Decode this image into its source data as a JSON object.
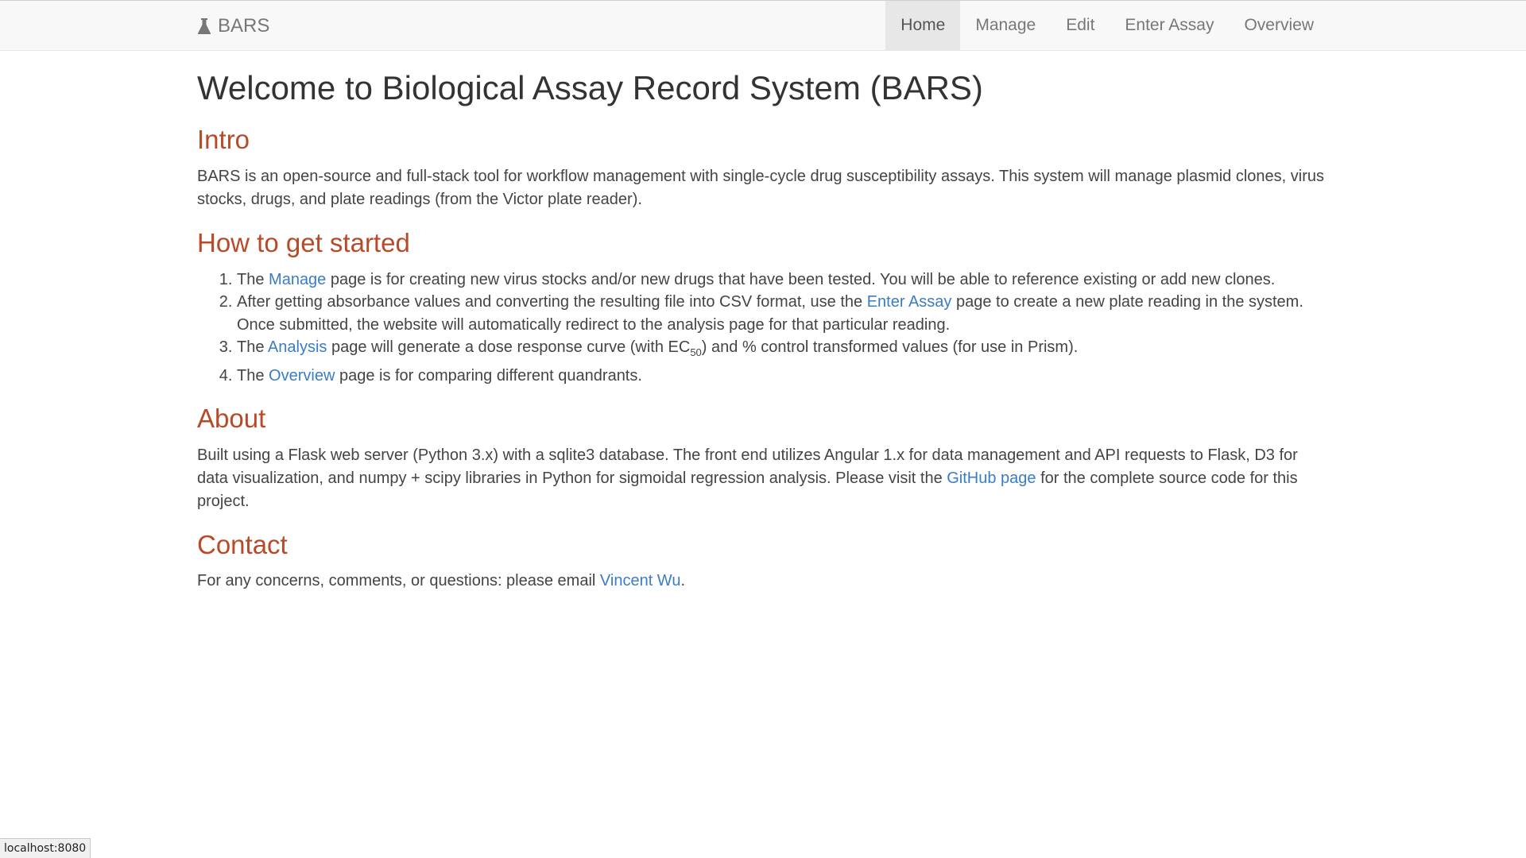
{
  "navbar": {
    "brand": "BARS",
    "items": [
      {
        "label": "Home",
        "active": true
      },
      {
        "label": "Manage",
        "active": false
      },
      {
        "label": "Edit",
        "active": false
      },
      {
        "label": "Enter Assay",
        "active": false
      },
      {
        "label": "Overview",
        "active": false
      }
    ]
  },
  "page": {
    "title": "Welcome to Biological Assay Record System (BARS)"
  },
  "intro": {
    "heading": "Intro",
    "text": "BARS is an open-source and full-stack tool for workflow management with single-cycle drug susceptibility assays. This system will manage plasmid clones, virus stocks, drugs, and plate readings (from the Victor plate reader)."
  },
  "getting_started": {
    "heading": "How to get started",
    "step1": {
      "before": "The ",
      "link": "Manage",
      "after": " page is for creating new virus stocks and/or new drugs that have been tested. You will be able to reference existing or add new clones."
    },
    "step2": {
      "before": "After getting absorbance values and converting the resulting file into CSV format, use the ",
      "link": "Enter Assay",
      "after": " page to create a new plate reading in the system. Once submitted, the website will automatically redirect to the analysis page for that particular reading."
    },
    "step3": {
      "before": "The ",
      "link": "Analysis",
      "middle": " page will generate a dose response curve (with EC",
      "sub": "50",
      "after": ") and % control transformed values (for use in Prism)."
    },
    "step4": {
      "before": "The ",
      "link": "Overview",
      "after": " page is for comparing different quandrants."
    }
  },
  "about": {
    "heading": "About",
    "before": "Built using a Flask web server (Python 3.x) with a sqlite3 database. The front end utilizes Angular 1.x for data management and API requests to Flask, D3 for data visualization, and numpy + scipy libraries in Python for sigmoidal regression analysis. Please visit the ",
    "link": "GitHub page",
    "after": " for the complete source code for this project."
  },
  "contact": {
    "heading": "Contact",
    "before": "For any concerns, comments, or questions: please email ",
    "link": "Vincent Wu",
    "after": "."
  },
  "status_bar": {
    "url": "localhost:8080"
  },
  "colors": {
    "heading_accent": "#b94a28",
    "link": "#3a7cc6",
    "navbar_bg": "#f8f8f8"
  },
  "icons": {
    "brand": "flask-icon"
  }
}
